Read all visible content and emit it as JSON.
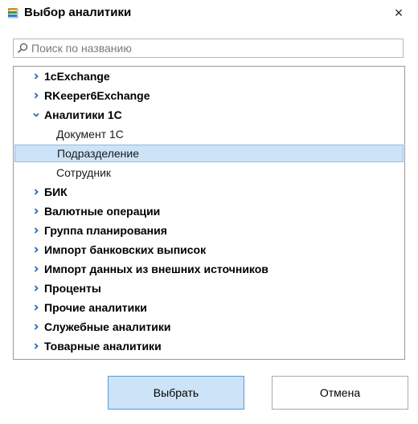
{
  "window": {
    "title": "Выбор аналитики",
    "close_glyph": "×"
  },
  "search": {
    "placeholder": "Поиск по названию",
    "value": ""
  },
  "tree": {
    "items": [
      {
        "label": "1cExchange",
        "level": 0,
        "expanded": false,
        "selected": false
      },
      {
        "label": "RKeeper6Exchange",
        "level": 0,
        "expanded": false,
        "selected": false
      },
      {
        "label": "Аналитики 1С",
        "level": 0,
        "expanded": true,
        "selected": false
      },
      {
        "label": "Документ 1С",
        "level": 1,
        "expanded": false,
        "selected": false
      },
      {
        "label": "Подразделение",
        "level": 1,
        "expanded": false,
        "selected": true
      },
      {
        "label": "Сотрудник",
        "level": 1,
        "expanded": false,
        "selected": false
      },
      {
        "label": "БИК",
        "level": 0,
        "expanded": false,
        "selected": false
      },
      {
        "label": "Валютные операции",
        "level": 0,
        "expanded": false,
        "selected": false
      },
      {
        "label": "Группа планирования",
        "level": 0,
        "expanded": false,
        "selected": false
      },
      {
        "label": "Импорт банковских выписок",
        "level": 0,
        "expanded": false,
        "selected": false
      },
      {
        "label": "Импорт данных из внешних источников",
        "level": 0,
        "expanded": false,
        "selected": false
      },
      {
        "label": "Проценты",
        "level": 0,
        "expanded": false,
        "selected": false
      },
      {
        "label": "Прочие аналитики",
        "level": 0,
        "expanded": false,
        "selected": false
      },
      {
        "label": "Служебные аналитики",
        "level": 0,
        "expanded": false,
        "selected": false
      },
      {
        "label": "Товарные аналитики",
        "level": 0,
        "expanded": false,
        "selected": false
      }
    ]
  },
  "buttons": {
    "select_label": "Выбрать",
    "cancel_label": "Отмена"
  },
  "icons": {
    "app": "folder-stack-icon",
    "search": "search-icon",
    "expand": "chevron-right-icon",
    "collapse": "chevron-down-icon"
  },
  "colors": {
    "selection_bg": "#cde3f7",
    "selection_border": "#8dbbe5",
    "primary_button_bg": "#cde3f7",
    "primary_button_border": "#5b9bd5",
    "chevron": "#1f6fc0"
  }
}
